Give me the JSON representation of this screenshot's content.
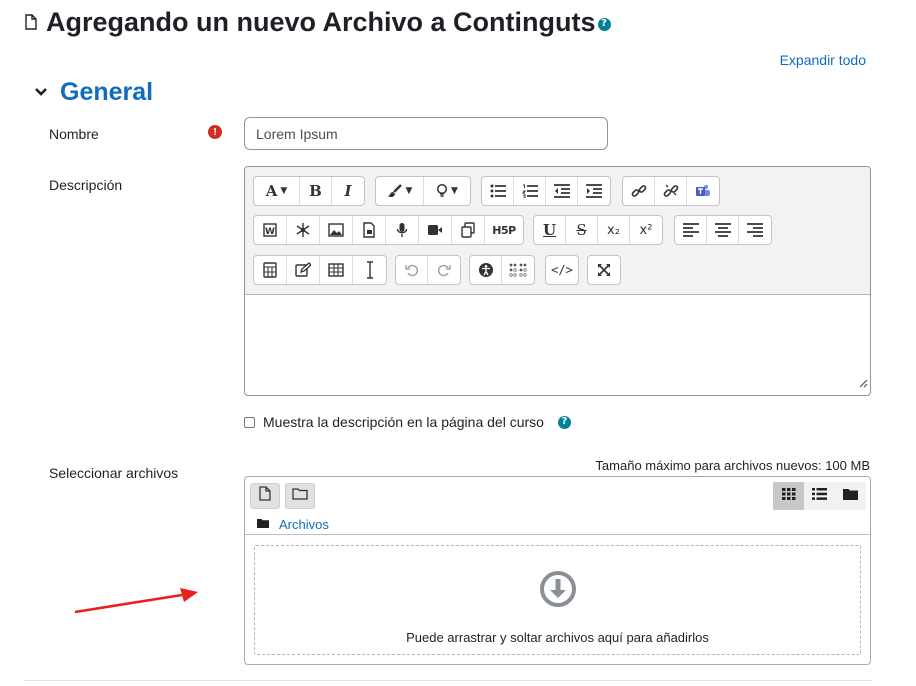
{
  "page": {
    "title": "Agregando un nuevo Archivo a Contingut",
    "title_suffix": "s",
    "help_glyph": "?",
    "icon": "document-icon"
  },
  "expand_all": "Expandir todo",
  "section": {
    "title": "General",
    "icon": "chevron-down-icon"
  },
  "form": {
    "name_label": "Nombre",
    "name_value": "Lorem Ipsum",
    "required_glyph": "!",
    "description_label": "Descripción",
    "show_description_label": "Muestra la descripción en la página del curso",
    "select_files_label": "Seleccionar archivos"
  },
  "editor": {
    "rows": [
      [
        [
          "font-icon",
          "bold-icon",
          "italic-icon"
        ],
        [
          "paint-brush-icon",
          "lightbulb-icon"
        ],
        [
          "unordered-list-icon",
          "ordered-list-icon",
          "outdent-icon",
          "indent-icon"
        ],
        [
          "link-icon",
          "unlink-icon",
          "teams-icon"
        ]
      ],
      [
        [
          "word-paste-icon",
          "snowflake-icon",
          "image-icon",
          "media-file-icon",
          "microphone-icon",
          "video-camera-icon",
          "copy-icon",
          "h5p-icon"
        ],
        [
          "underline-icon",
          "strikethrough-icon",
          "subscript-icon",
          "superscript-icon"
        ],
        [
          "align-left-icon",
          "align-center-icon",
          "align-right-icon"
        ]
      ],
      [
        [
          "calculator-icon",
          "edit-icon",
          "table-icon",
          "text-cursor-icon"
        ],
        [
          "undo-icon",
          "redo-icon"
        ],
        [
          "accessibility-icon",
          "braille-icon"
        ],
        [
          "html-code-icon"
        ],
        [
          "fullscreen-icon"
        ]
      ]
    ],
    "glyphs": {
      "bold": "B",
      "italic": "I",
      "font": "A",
      "underline": "U",
      "strike": "S",
      "sub": "x₂",
      "sup": "x²",
      "h5p": "H5P",
      "code": "</>"
    }
  },
  "filepicker": {
    "max_size": "Tamaño máximo para archivos nuevos: 100 MB",
    "path_label": "Archivos",
    "drop_text": "Puede arrastrar y soltar archivos aquí para añadirlos",
    "active_view": "icons"
  },
  "colors": {
    "accent": "#0f6cbf",
    "required": "#ca3120",
    "help": "#008196",
    "annotation_arrow": "#e8201d"
  }
}
